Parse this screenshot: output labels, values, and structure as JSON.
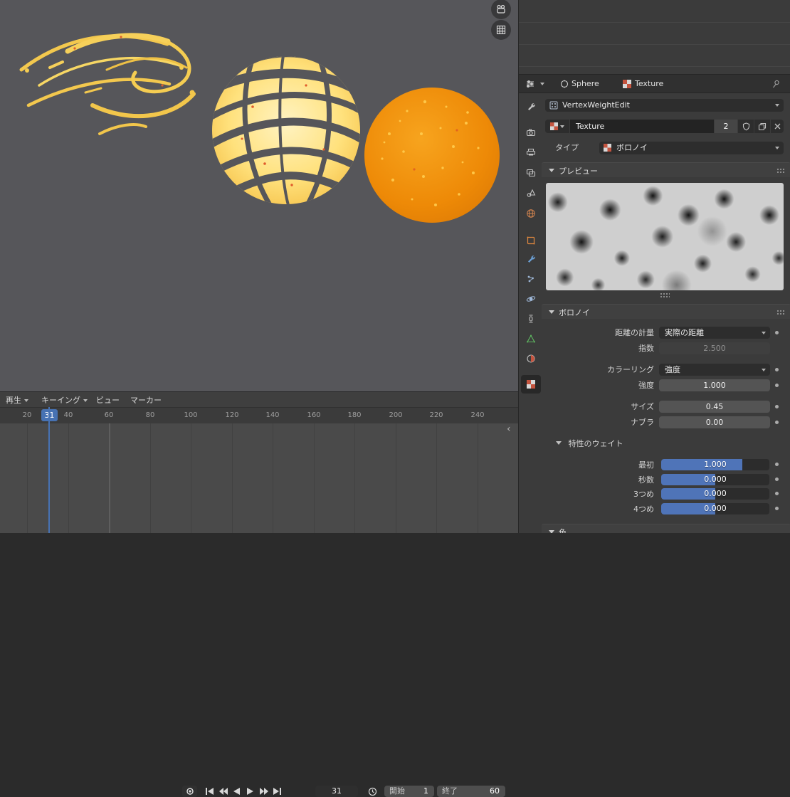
{
  "colors": {
    "accent": "#4772b3",
    "slider_fill": "#4f74b8"
  },
  "timeline": {
    "play_menu": "再生",
    "keying_menu": "キーイング",
    "view_menu": "ビュー",
    "marker_menu": "マーカー",
    "frame_field": "31",
    "current_frame": "31",
    "start_label": "開始",
    "start_value": "1",
    "end_label": "終了",
    "end_value": "60",
    "ticks": [
      "20",
      "40",
      "60",
      "80",
      "100",
      "120",
      "140",
      "160",
      "180",
      "200",
      "220",
      "240"
    ]
  },
  "properties": {
    "breadcrumb": {
      "object": "Sphere",
      "texture": "Texture"
    },
    "tabs": [
      "tool",
      "render",
      "output",
      "view-layer",
      "scene",
      "world",
      "object",
      "modifiers",
      "particles",
      "physics",
      "constraints",
      "object-data",
      "material",
      "texture"
    ],
    "active_tab": "texture",
    "modifier_selector": "VertexWeightEdit",
    "datablock": {
      "name": "Texture",
      "users": "2"
    },
    "type_label": "タイプ",
    "type_value": "ボロノイ",
    "sections": {
      "preview": "プレビュー",
      "voronoi": "ボロノイ",
      "weights": "特性のウェイト",
      "color": "色"
    },
    "voronoi": {
      "metric_label": "距離の計量",
      "metric_value": "実際の距離",
      "exponent_label": "指数",
      "exponent_value": "2.500",
      "coloring_label": "カラーリング",
      "coloring_value": "強度",
      "intensity_label": "強度",
      "intensity_value": "1.000",
      "size_label": "サイズ",
      "size_value": "0.45",
      "nabla_label": "ナブラ",
      "nabla_value": "0.00"
    },
    "weights": [
      {
        "label": "最初",
        "value": "1.000",
        "fill": 75
      },
      {
        "label": "秒数",
        "value": "0.000",
        "fill": 50
      },
      {
        "label": "3つめ",
        "value": "0.000",
        "fill": 50
      },
      {
        "label": "4つめ",
        "value": "0.000",
        "fill": 50
      }
    ]
  }
}
